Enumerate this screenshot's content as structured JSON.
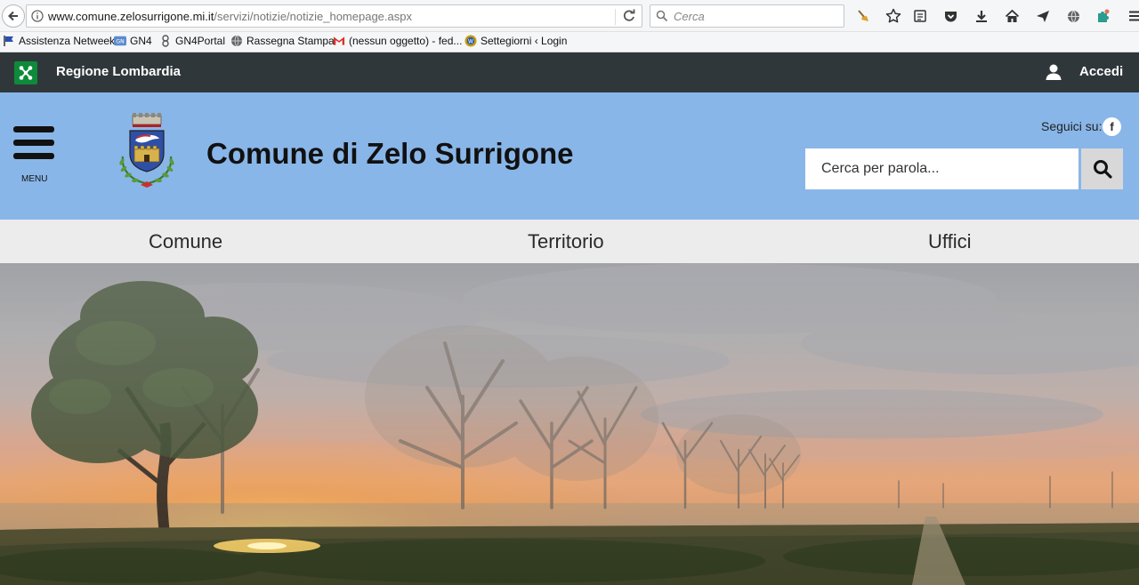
{
  "browser": {
    "url_domain": "www.comune.zelosurrigone.mi.it",
    "url_path": "/servizi/notizie/notizie_homepage.aspx",
    "search_placeholder": "Cerca",
    "bookmarks": [
      {
        "label": "Assistenza Netweek",
        "icon": "flag-icon"
      },
      {
        "label": "GN4",
        "icon": "gn4-icon"
      },
      {
        "label": "GN4Portal",
        "icon": "portal-icon"
      },
      {
        "label": "Rassegna Stampa",
        "icon": "globe-icon"
      },
      {
        "label": "(nessun oggetto) - fed...",
        "icon": "gmail-icon"
      },
      {
        "label": "Settegiorni ‹ Login",
        "icon": "wordpress-icon"
      }
    ]
  },
  "topbar": {
    "region_name": "Regione Lombardia",
    "login_label": "Accedi"
  },
  "header": {
    "menu_label": "MENU",
    "site_title": "Comune di Zelo Surrigone",
    "follow_label": "Seguici su:",
    "search_placeholder": "Cerca per parola..."
  },
  "nav": {
    "items": [
      "Comune",
      "Territorio",
      "Uffici"
    ]
  },
  "colors": {
    "topbar": "#30373b",
    "header": "#89b6e8",
    "nav": "#ececec",
    "region_green": "#0e8a3a"
  }
}
